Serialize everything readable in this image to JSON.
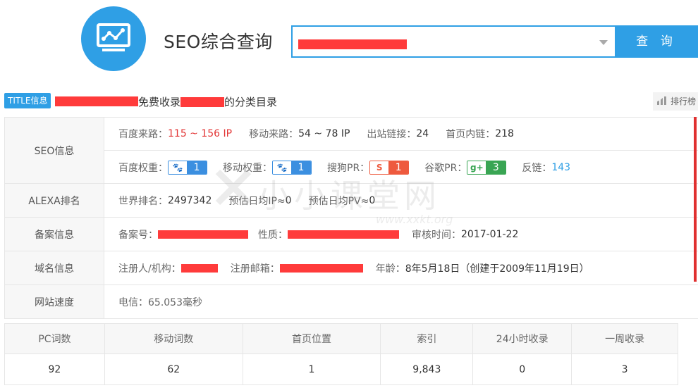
{
  "header": {
    "app_title": "SEO综合查询",
    "search_placeholder": "",
    "search_button": "查 询",
    "logo_icon": "chart-monitor-icon",
    "accent_color": "#2f9fe5"
  },
  "title_line": {
    "badge": "TITLE信息",
    "text": "免费收录",
    "text2": "的分类目录",
    "rank_button": "排行榜"
  },
  "seo": {
    "label": "SEO信息",
    "line1": [
      {
        "key": "百度来路：",
        "value": "115 ~ 156 IP",
        "color": "#e23535"
      },
      {
        "key": "移动来路：",
        "value": "54 ~ 78 IP"
      },
      {
        "key": "出站链接：",
        "value": "24"
      },
      {
        "key": "首页内链：",
        "value": "218"
      }
    ],
    "line2": [
      {
        "key": "百度权重：",
        "icon": "paw-icon",
        "value": "1"
      },
      {
        "key": "移动权重：",
        "icon": "paw-icon",
        "value": "1"
      },
      {
        "key": "搜狗PR：",
        "icon": "sogou-icon",
        "value": "1"
      },
      {
        "key": "谷歌PR：",
        "icon": "google-plus-icon",
        "value": "3"
      },
      {
        "key": "反链：",
        "value": "143",
        "color": "#2f9fe5"
      }
    ]
  },
  "alexa": {
    "label": "ALEXA排名",
    "world_rank_key": "世界排名：",
    "world_rank": "2497342",
    "ip_key": "预估日均IP≈",
    "ip": "0",
    "pv_key": "预估日均PV≈",
    "pv": "0"
  },
  "beian": {
    "label": "备案信息",
    "number_key": "备案号：",
    "nature_key": "性质：",
    "audit_key": "审核时间：",
    "audit_time": "2017-01-22"
  },
  "domain": {
    "label": "域名信息",
    "registrant_key": "注册人/机构：",
    "email_key": "注册邮箱：",
    "age_key": "年龄：",
    "age": "8年5月18日（创建于2009年11月19日）"
  },
  "speed": {
    "label": "网站速度",
    "value": "电信：65.053毫秒"
  },
  "watermark": {
    "text": "小小课堂网",
    "url": "www.xxkt.org"
  },
  "stats": {
    "headers": [
      "PC词数",
      "移动词数",
      "首页位置",
      "索引",
      "24小时收录",
      "一周收录"
    ],
    "values": [
      "92",
      "62",
      "1",
      "9,843",
      "0",
      "3"
    ]
  }
}
